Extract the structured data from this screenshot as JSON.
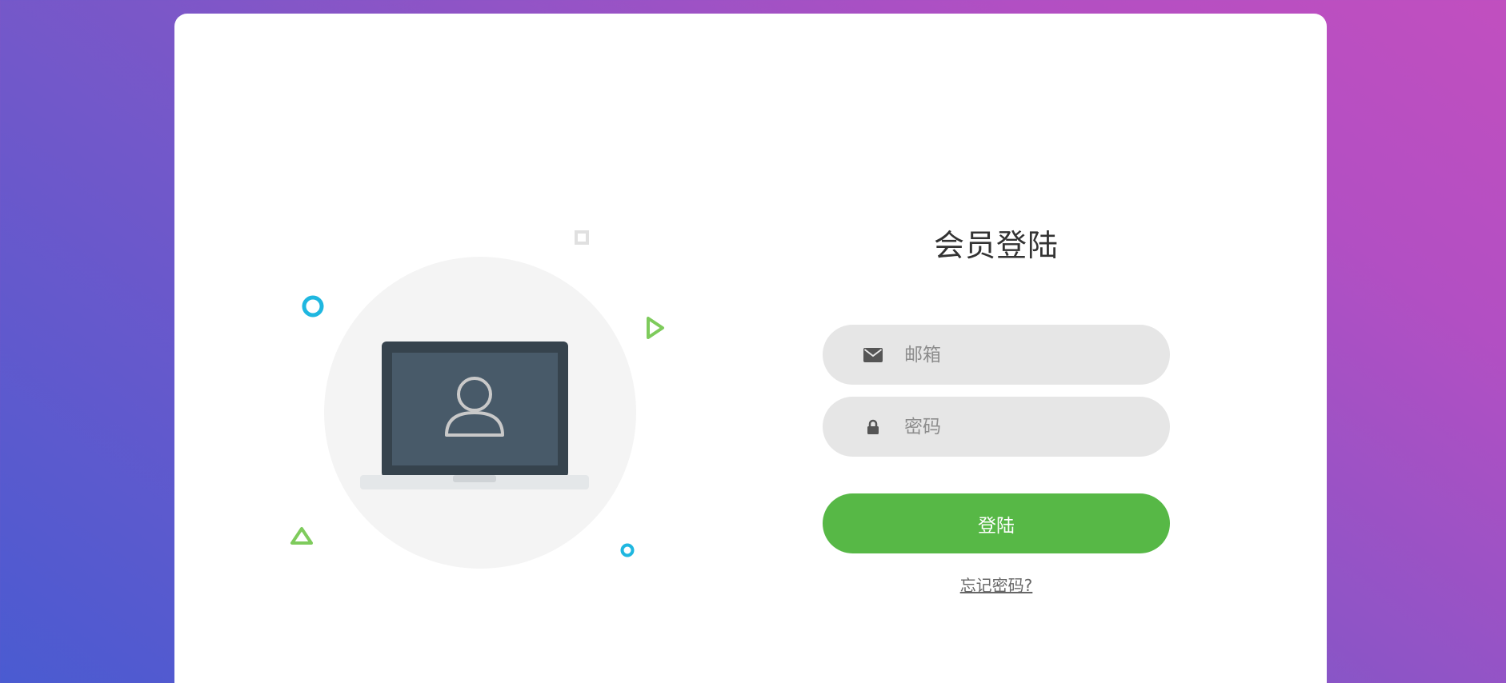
{
  "login": {
    "title": "会员登陆",
    "email_placeholder": "邮箱",
    "password_placeholder": "密码",
    "submit_label": "登陆",
    "forgot_label": "忘记密码?"
  },
  "icons": {
    "email": "envelope-icon",
    "password": "lock-icon",
    "illustration": "laptop-user-icon"
  },
  "colors": {
    "accent": "#57b846",
    "field_bg": "#e6e6e6",
    "gradient_start": "#4a5bd1",
    "gradient_end": "#c14fbf",
    "decor_blue": "#1fb7e0",
    "decor_green": "#7ecb5c"
  }
}
